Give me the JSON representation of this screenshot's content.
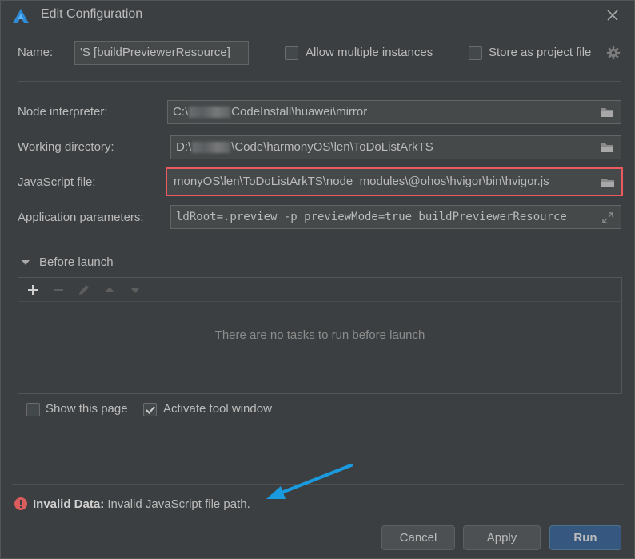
{
  "dialog": {
    "title": "Edit Configuration"
  },
  "name_row": {
    "label": "Name:",
    "value": "'S [buildPreviewerResource]",
    "allow_multiple_label": "Allow multiple instances",
    "allow_multiple_checked": false,
    "store_project_label": "Store as project file",
    "store_project_checked": false
  },
  "node_interpreter": {
    "label": "Node interpreter:",
    "value_prefix": "C:\\",
    "value_suffix": "CodeInstall\\huawei\\mirror"
  },
  "working_directory": {
    "label": "Working directory:",
    "value_prefix": "D:\\",
    "value_suffix": "\\Code\\harmonyOS\\len\\ToDoListArkTS"
  },
  "javascript_file": {
    "label": "JavaScript file:",
    "value": "monyOS\\len\\ToDoListArkTS\\node_modules\\@ohos\\hvigor\\bin\\hvigor.js"
  },
  "app_params": {
    "label": "Application parameters:",
    "value": "ldRoot=.preview -p previewMode=true buildPreviewerResource"
  },
  "before_launch": {
    "label": "Before launch",
    "empty_message": "There are no tasks to run before launch"
  },
  "options": {
    "show_page_label": "Show this page",
    "show_page_checked": false,
    "activate_tool_label": "Activate tool window",
    "activate_tool_checked": true
  },
  "validation": {
    "title": "Invalid Data:",
    "message": "Invalid JavaScript file path."
  },
  "buttons": {
    "cancel": "Cancel",
    "apply": "Apply",
    "run": "Run"
  },
  "colors": {
    "background": "#3c3f41",
    "field_bg": "#45494a",
    "error_border": "#ec5a5f",
    "primary_button": "#365880",
    "annotation_arrow": "#1a9be0"
  }
}
